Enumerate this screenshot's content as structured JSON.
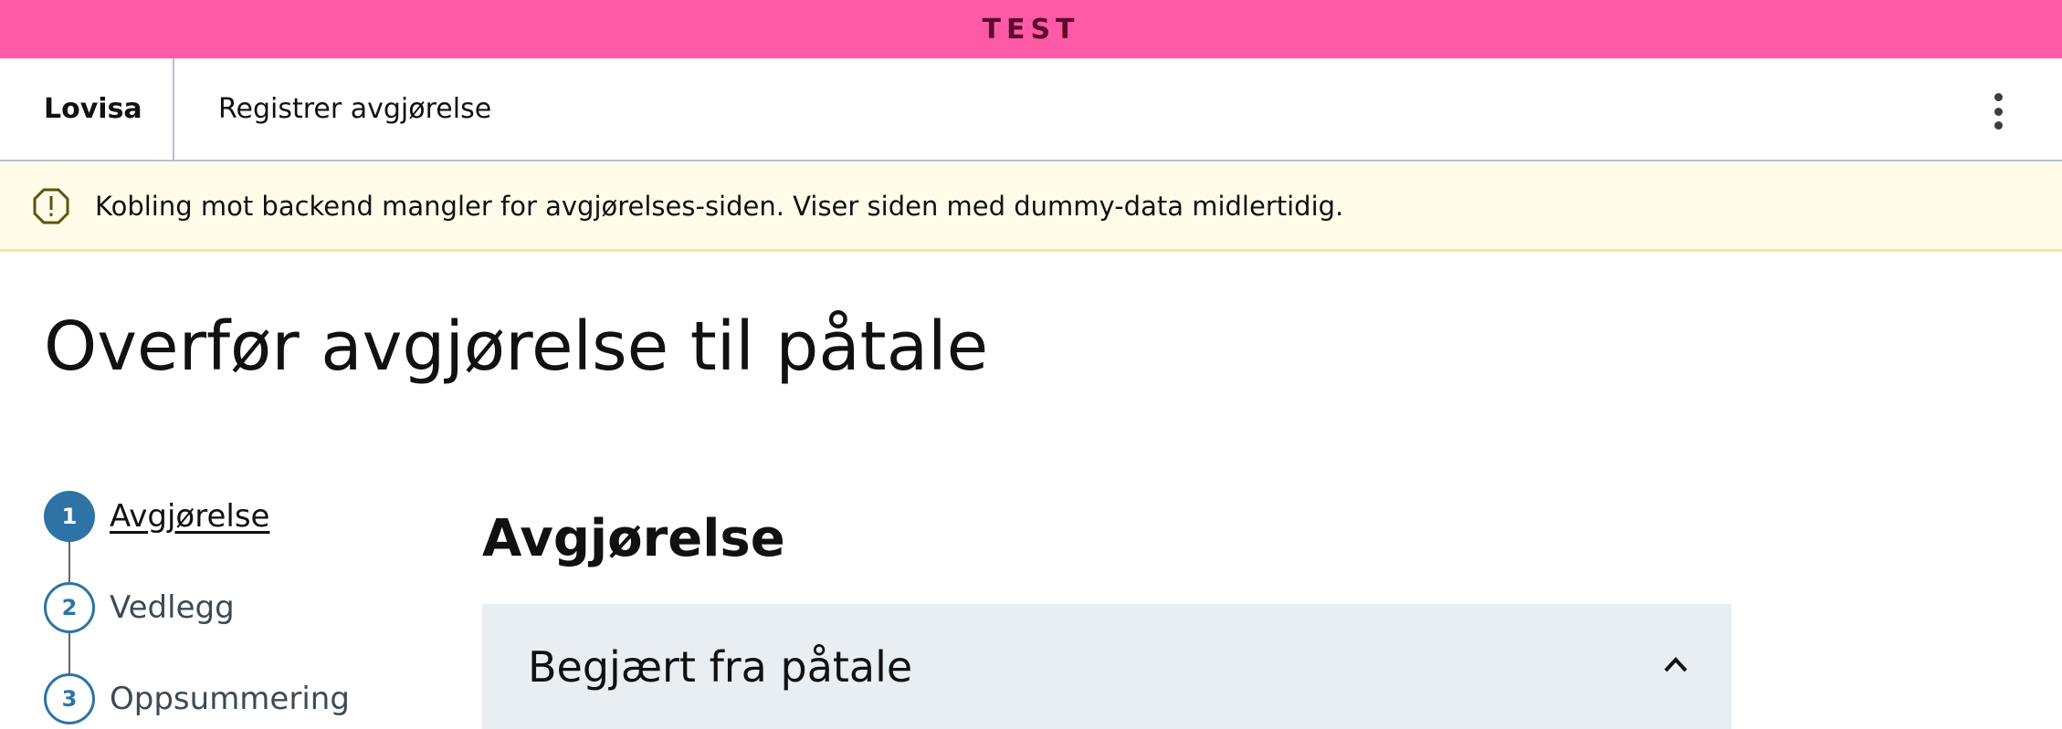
{
  "environment": {
    "label": "TEST",
    "color": "#ff5aa5"
  },
  "header": {
    "app_name": "Lovisa",
    "page_title": "Registrer avgjørelse",
    "menu_icon": "kebab-menu-icon"
  },
  "banner": {
    "icon": "warning-octagon-icon",
    "message": "Kobling mot backend mangler for avgjørelses-siden. Viser siden med dummy-data midlertidig.",
    "background": "#fefce8"
  },
  "main": {
    "title": "Overfør avgjørelse til påtale",
    "steps": [
      {
        "number": "1",
        "label": "Avgjørelse",
        "active": true
      },
      {
        "number": "2",
        "label": "Vedlegg",
        "active": false
      },
      {
        "number": "3",
        "label": "Oppsummering",
        "active": false
      }
    ],
    "section_title": "Avgjørelse",
    "accordion": {
      "label": "Begjært fra påtale",
      "expanded": true,
      "icon": "chevron-up-icon"
    }
  },
  "colors": {
    "accent": "#2d73a6",
    "accordion_bg": "#e9eef2"
  }
}
